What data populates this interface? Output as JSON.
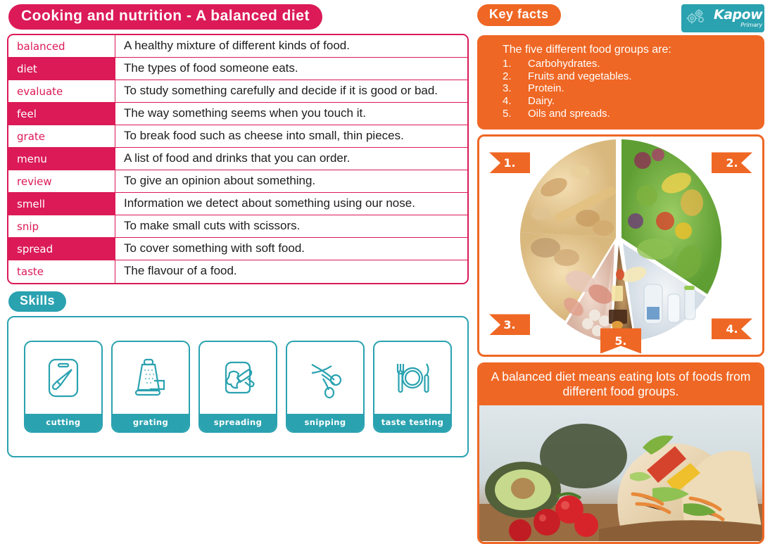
{
  "page": {
    "title": "Cooking and nutrition - A balanced diet"
  },
  "brand": {
    "logo_name": "Kapow",
    "logo_sub": "Primary",
    "logo_icon": "gears-icon",
    "teal": "#2AA2B0",
    "pink": "#DB1A57",
    "orange": "#EF6724"
  },
  "vocabulary": {
    "rows": [
      {
        "term": "balanced",
        "definition": "A healthy mixture of different kinds of food."
      },
      {
        "term": "diet",
        "definition": "The types of food someone eats."
      },
      {
        "term": "evaluate",
        "definition": "To study something carefully and decide if it is good or bad."
      },
      {
        "term": "feel",
        "definition": "The way something seems when you touch it."
      },
      {
        "term": "grate",
        "definition": "To break food such as cheese into small, thin pieces."
      },
      {
        "term": "menu",
        "definition": "A list of food and drinks that you can order."
      },
      {
        "term": "review",
        "definition": "To give an opinion about something."
      },
      {
        "term": "smell",
        "definition": "Information we detect about something using our nose."
      },
      {
        "term": "snip",
        "definition": "To make small cuts with scissors."
      },
      {
        "term": "spread",
        "definition": "To cover something with soft food."
      },
      {
        "term": "taste",
        "definition": "The flavour of a food."
      }
    ]
  },
  "skills": {
    "heading": "Skills",
    "items": [
      {
        "label": "cutting",
        "icon": "chopping-board-knife-icon"
      },
      {
        "label": "grating",
        "icon": "cheese-grater-icon"
      },
      {
        "label": "spreading",
        "icon": "bread-spreading-knife-icon"
      },
      {
        "label": "snipping",
        "icon": "scissors-icon"
      },
      {
        "label": "taste testing",
        "icon": "plate-fork-knife-icon"
      }
    ]
  },
  "key_facts": {
    "heading": "Key facts",
    "lead": "The five different food groups are:",
    "items": [
      {
        "num": "1.",
        "text": "Carbohydrates."
      },
      {
        "num": "2.",
        "text": "Fruits and vegetables."
      },
      {
        "num": "3.",
        "text": "Protein."
      },
      {
        "num": "4.",
        "text": "Dairy."
      },
      {
        "num": "5.",
        "text": "Oils and spreads."
      }
    ]
  },
  "plate_figure": {
    "image_alt": "eatwell-plate-photo",
    "tags": [
      {
        "label": "1.",
        "group": "carbohydrates"
      },
      {
        "label": "2.",
        "group": "fruits-and-vegetables"
      },
      {
        "label": "3.",
        "group": "protein"
      },
      {
        "label": "4.",
        "group": "dairy"
      },
      {
        "label": "5.",
        "group": "oils-and-spreads"
      }
    ]
  },
  "bottom_card": {
    "caption": "A balanced diet means eating lots of foods from different food groups.",
    "image_alt": "salad-wraps-photo"
  }
}
